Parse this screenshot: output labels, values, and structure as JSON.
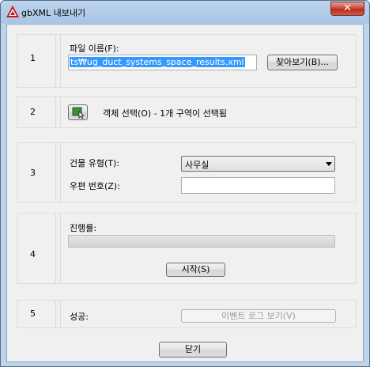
{
  "window": {
    "title": "gbXML 내보내기",
    "close_icon": "✕",
    "app_icon": "autocad-logo-icon"
  },
  "steps": [
    {
      "number": "1"
    },
    {
      "number": "2"
    },
    {
      "number": "3"
    },
    {
      "number": "4"
    },
    {
      "number": "5"
    }
  ],
  "step1": {
    "file_name_label": "파일 이름(F):",
    "file_name_value": "ts₩ug_duct_systems_space_results.xml",
    "browse_label": "찾아보기(B)..."
  },
  "step2": {
    "select_icon": "select-objects-icon",
    "status_text": "객체 선택(O) - 1개 구역이 선택됨"
  },
  "step3": {
    "building_type_label": "건물 유형(T):",
    "building_type_value": "사무실",
    "postal_code_label": "우편 번호(Z):",
    "postal_code_value": ""
  },
  "step4": {
    "progress_label": "진행률:",
    "progress_fraction": 0,
    "start_label": "시작(S)"
  },
  "step5": {
    "success_label": "성공:",
    "event_log_label": "이벤트 로그 보기(V)"
  },
  "footer": {
    "close_label": "닫기"
  }
}
